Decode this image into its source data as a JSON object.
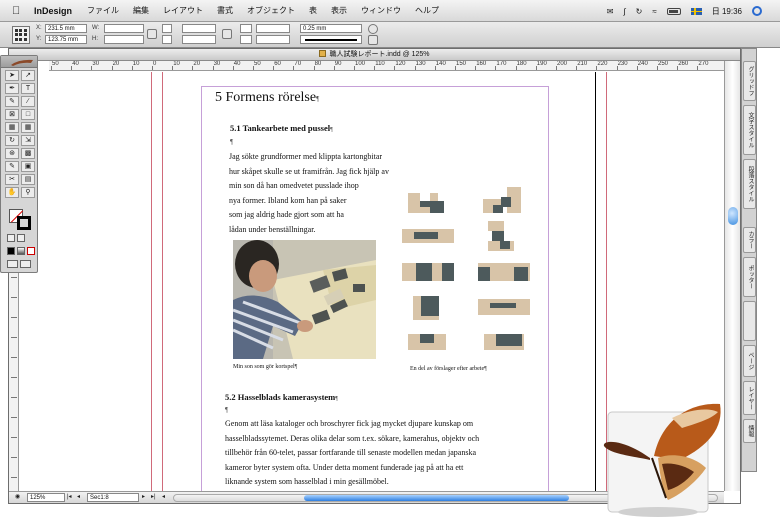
{
  "menubar": {
    "app_name": "InDesign",
    "menus": [
      "ファイル",
      "編集",
      "レイアウト",
      "書式",
      "オブジェクト",
      "表",
      "表示",
      "ウィンドウ",
      "ヘルプ"
    ],
    "clock": "日 19:36"
  },
  "control_panel": {
    "x_label": "X:",
    "x_value": "231.5 mm",
    "y_label": "Y:",
    "y_value": "123.75 mm",
    "w_label": "W:",
    "h_label": "H:",
    "stroke_weight": "0.25 mm"
  },
  "document": {
    "title": "職人試験レポート.indd @ 125%",
    "zoom": "125%",
    "page_field": "Sec1:8",
    "ruler_labels": [
      "50",
      "40",
      "30",
      "20",
      "10",
      "0",
      "10",
      "20",
      "30",
      "40",
      "50",
      "60",
      "70",
      "80",
      "90",
      "100",
      "110",
      "120",
      "130",
      "140",
      "150",
      "160",
      "170",
      "180",
      "190",
      "200",
      "210",
      "220",
      "230",
      "240",
      "250",
      "260",
      "270"
    ]
  },
  "page": {
    "heading": "5 Formens rörelse",
    "section1": {
      "title": "5.1 Tankearbete med pussel",
      "lines": [
        "Jag sökte grundformer med klippta kartongbitar",
        "hur skåpet skulle se ut framifrån. Jag fick hjälp av",
        "min son då han omedvetet pusslade ihop",
        "nya former. Ibland kom han på saker",
        "som jag aldrig hade gjort som att ha",
        "lådan under benställningar."
      ]
    },
    "caption_left": "Min son som gör kortspel",
    "caption_right": "En del av förslager efter arbete",
    "section2": {
      "title": "5.2 Hasselblads kamerasystem",
      "lines": [
        "Genom att läsa kataloger och broschyrer fick jag mycket djupare kunskap om",
        "hasselbladssytemet. Deras olika delar som t.ex. sökare, kamerahus, objektv och",
        "tillbehör från 60-telet, passar fortfarande till senaste modellen medan japanska",
        "kameror byter system ofta. Under detta moment funderade jag på att ha ett",
        "liknande system som hasselblad i min gesällmöbel."
      ]
    },
    "pilcrow": "¶"
  },
  "dock": {
    "tabs": [
      "グリッドフ",
      "文字スタイル",
      "段落スタイル",
      "カラー",
      "ポッター",
      "レイヤー",
      "ページ",
      "情報"
    ]
  },
  "icons": [
    "apple-icon",
    "spotlight-icon",
    "wifi-icon",
    "battery-icon",
    "flag-icon",
    "reference-point-icon",
    "butterfly-icon"
  ],
  "colors": {
    "guide_red": "#d06a7a",
    "page_border": "#c6a0d8",
    "scroll_blue": "#2f7fe0",
    "tangram_dark": "#4d5a5c",
    "tangram_beige": "#d8c4a8"
  }
}
